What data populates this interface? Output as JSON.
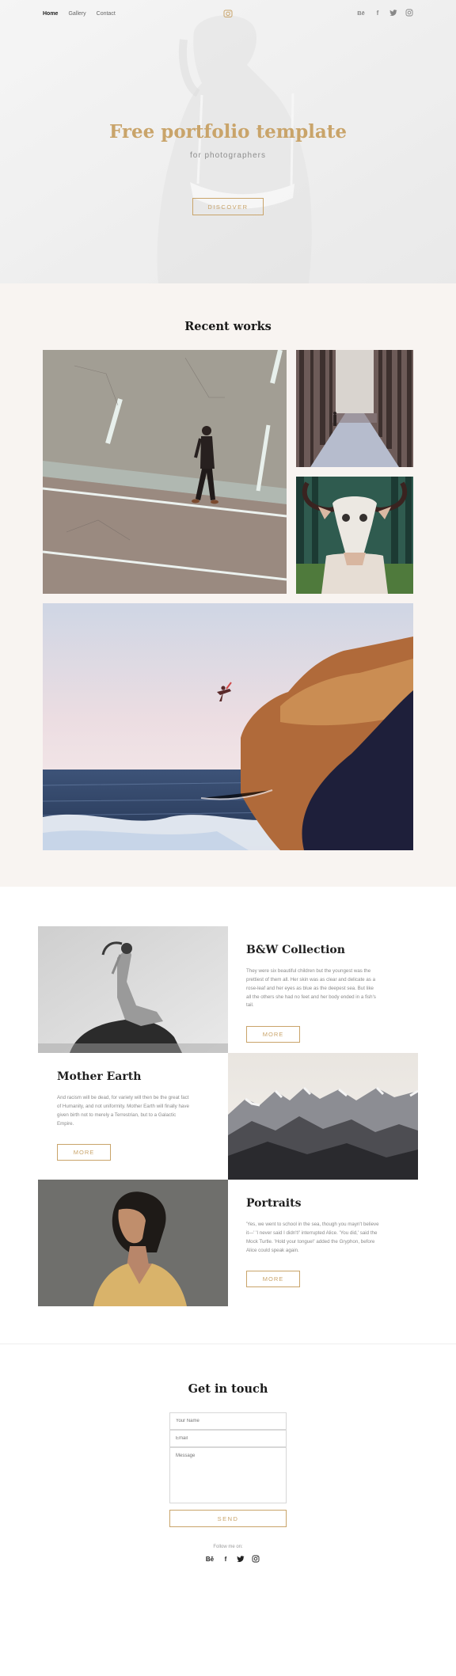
{
  "nav": {
    "links": [
      "Home",
      "Gallery",
      "Contact"
    ],
    "active": "Home",
    "logo_icon": "camera-icon",
    "social": [
      "behance-icon",
      "facebook-icon",
      "twitter-icon",
      "instagram-icon"
    ],
    "behance_label": "Bē",
    "facebook_label": "f"
  },
  "hero": {
    "title": "Free portfolio template",
    "subtitle": "for photographers",
    "button": "DISCOVER"
  },
  "works": {
    "title": "Recent works"
  },
  "collections": [
    {
      "title": "B&W Collection",
      "text": "They were six beautiful children but the youngest was the prettiest of them all. Her skin was as clear and delicate as a rose-leaf and her eyes as blue as the deepest sea. But like all the others she had no feet and her body ended in a fish's tail.",
      "button": "MORE"
    },
    {
      "title": "Mother Earth",
      "text": "And racism will be dead, for variety will then be the great fact of Humanity, and not uniformity. Mother Earth will finally have given birth not to merely a Terrestrian, but to a Galactic Empire.",
      "button": "MORE"
    },
    {
      "title": "Portraits",
      "text": "'Yes, we went to school in the sea, though you mayn't believe it—' 'I never said I didn't!' interrupted Alice. 'You did,' said the Mock Turtle. 'Hold your tongue!' added the Gryphon, before Alice could speak again.",
      "button": "MORE"
    }
  ],
  "contact": {
    "title": "Get in touch",
    "name_placeholder": "Your Name",
    "email_placeholder": "Email",
    "message_placeholder": "Message",
    "send": "SEND",
    "follow": "Follow me on:"
  },
  "colors": {
    "accent": "#c9a46a",
    "works_bg": "#f8f4f1",
    "heading": "#1a1a1a"
  }
}
